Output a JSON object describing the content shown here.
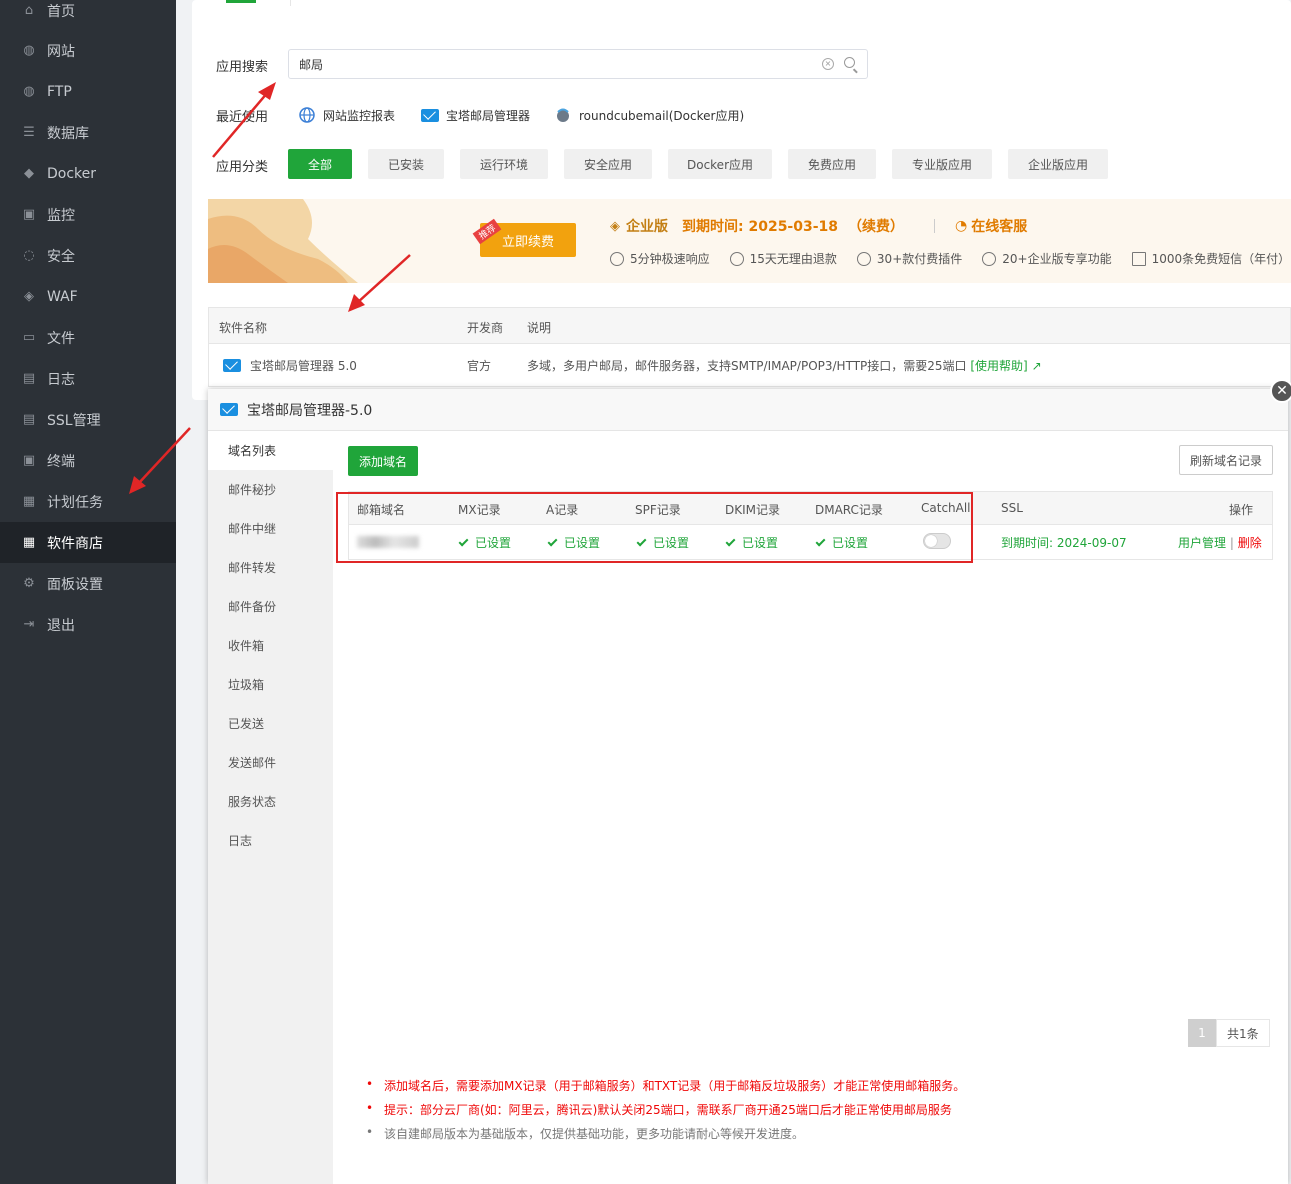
{
  "sidebar": {
    "items": [
      {
        "label": "首页",
        "icon": "home-icon",
        "glyph": "⌂"
      },
      {
        "label": "网站",
        "icon": "globe-icon",
        "glyph": "◍"
      },
      {
        "label": "FTP",
        "icon": "ftp-icon",
        "glyph": "◍"
      },
      {
        "label": "数据库",
        "icon": "database-icon",
        "glyph": "☰"
      },
      {
        "label": "Docker",
        "icon": "docker-icon",
        "glyph": "◆"
      },
      {
        "label": "监控",
        "icon": "monitor-icon",
        "glyph": "▣"
      },
      {
        "label": "安全",
        "icon": "shield-icon",
        "glyph": "◌"
      },
      {
        "label": "WAF",
        "icon": "waf-icon",
        "glyph": "◈"
      },
      {
        "label": "文件",
        "icon": "folder-icon",
        "glyph": "▭"
      },
      {
        "label": "日志",
        "icon": "log-icon",
        "glyph": "▤"
      },
      {
        "label": "SSL管理",
        "icon": "ssl-icon",
        "glyph": "▤"
      },
      {
        "label": "终端",
        "icon": "terminal-icon",
        "glyph": "▣"
      },
      {
        "label": "计划任务",
        "icon": "schedule-icon",
        "glyph": "▦"
      },
      {
        "label": "软件商店",
        "icon": "store-icon",
        "glyph": "▦"
      },
      {
        "label": "面板设置",
        "icon": "gear-icon",
        "glyph": "⚙"
      },
      {
        "label": "退出",
        "icon": "logout-icon",
        "glyph": "⇥"
      }
    ],
    "active": "软件商店"
  },
  "store": {
    "search_label": "应用搜索",
    "search_value": "邮局",
    "recent_label": "最近使用",
    "recent": [
      "网站监控报表",
      "宝塔邮局管理器",
      "roundcubemail(Docker应用)"
    ],
    "category_label": "应用分类",
    "categories": [
      "全部",
      "已安装",
      "运行环境",
      "安全应用",
      "Docker应用",
      "免费应用",
      "专业版应用",
      "企业版应用"
    ],
    "banner": {
      "badge": "推荐",
      "renew": "立即续费",
      "edition": "企业版",
      "expire": "到期时间: 2025-03-18",
      "renew_link": "（续费）",
      "service": "在线客服",
      "perks": [
        "5分钟极速响应",
        "15天无理由退款",
        "30+款付费插件",
        "20+企业版专享功能",
        "1000条免费短信（年付）"
      ]
    },
    "table": {
      "headers": [
        "软件名称",
        "开发商",
        "说明"
      ],
      "row": {
        "name": "宝塔邮局管理器 5.0",
        "vendor": "官方",
        "desc": "多域，多用户邮局，邮件服务器，支持SMTP/IMAP/POP3/HTTP接口，需要25端口",
        "help": "[使用帮助]"
      }
    }
  },
  "modal": {
    "title": "宝塔邮局管理器-5.0",
    "menu": [
      "域名列表",
      "邮件秘抄",
      "邮件中继",
      "邮件转发",
      "邮件备份",
      "收件箱",
      "垃圾箱",
      "已发送",
      "发送邮件",
      "服务状态",
      "日志"
    ],
    "add_domain": "添加域名",
    "refresh": "刷新域名记录",
    "headers": [
      "邮箱域名",
      "MX记录",
      "A记录",
      "SPF记录",
      "DKIM记录",
      "DMARC记录",
      "CatchAll",
      "SSL",
      "操作"
    ],
    "row": {
      "status": "已设置",
      "ssl": "到期时间: 2024-09-07",
      "user_mgmt": "用户管理",
      "sep": "|",
      "delete": "删除"
    },
    "pager": {
      "page": "1",
      "total": "共1条"
    },
    "notes": [
      "添加域名后，需要添加MX记录（用于邮箱服务）和TXT记录（用于邮箱反垃圾服务）才能正常使用邮箱服务。",
      "提示：部分云厂商(如：阿里云，腾讯云)默认关闭25端口，需联系厂商开通25端口后才能正常使用邮局服务",
      "该自建邮局版本为基础版本，仅提供基础功能，更多功能请耐心等候开发进度。"
    ]
  },
  "colors": {
    "accent": "#20a53a",
    "sidebar_bg": "#2c3137",
    "danger": "#ef0808",
    "annotation": "#e02626"
  }
}
